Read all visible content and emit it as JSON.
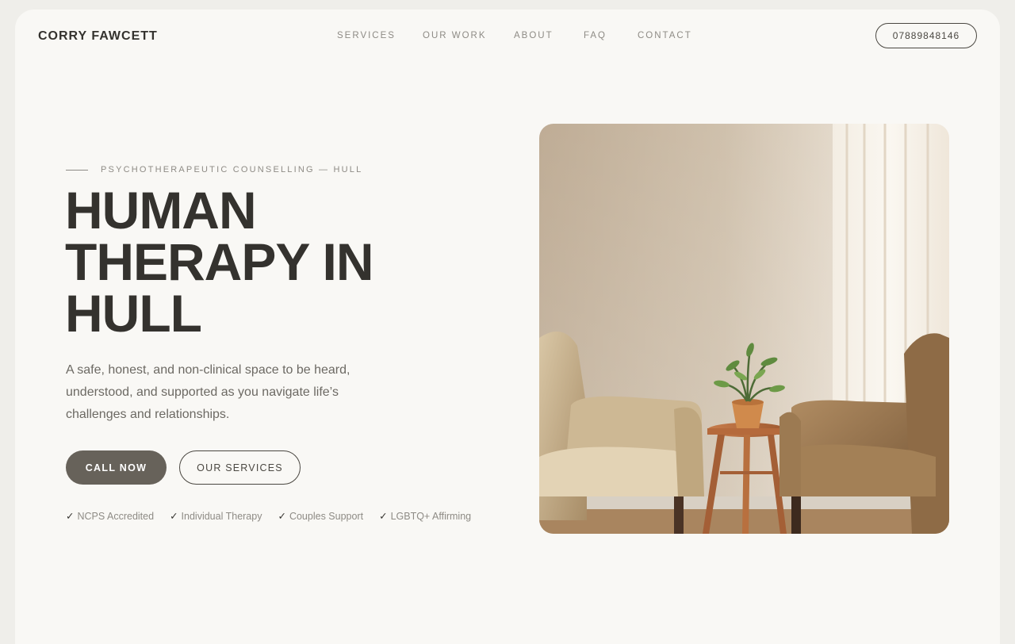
{
  "header": {
    "brand": "CORRY FAWCETT",
    "nav": [
      "SERVICES",
      "OUR WORK",
      "ABOUT",
      "FAQ",
      "CONTACT"
    ],
    "phone": "07889848146"
  },
  "hero": {
    "eyebrow": "PSYCHOTHERAPEUTIC COUNSELLING — HULL",
    "headline_lines": [
      "HUMAN",
      "THERAPY IN",
      "HULL"
    ],
    "description": "A safe, honest, and non-clinical space to be heard, understood, and supported as you navigate life’s challenges and relationships.",
    "cta_primary": "CALL NOW",
    "cta_secondary": "OUR SERVICES",
    "badges": [
      "NCPS Accredited",
      "Individual Therapy",
      "Couples Support",
      "LGBTQ+ Affirming"
    ],
    "check_glyph": "✓",
    "image_icon": "therapy-room-image"
  },
  "colors": {
    "text_dark": "#34322e",
    "text_muted": "#8e8b85",
    "primary_button": "#67625a",
    "page_background": "#f9f8f5"
  }
}
